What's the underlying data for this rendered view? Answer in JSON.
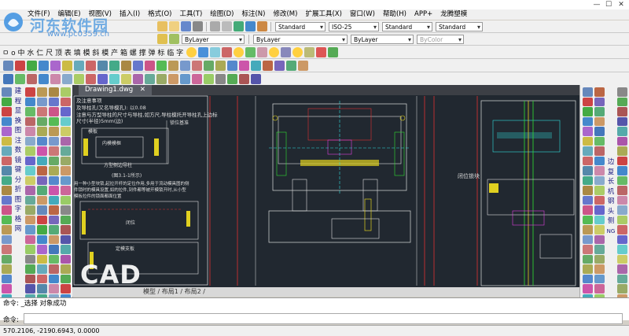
{
  "menu": {
    "items": [
      "文件(F)",
      "编辑(E)",
      "视图(V)",
      "插入(I)",
      "格式(O)",
      "工具(T)",
      "绘图(D)",
      "标注(N)",
      "修改(M)",
      "扩展工具(X)",
      "窗口(W)",
      "帮助(H)",
      "APP+",
      "龙腾塑模"
    ]
  },
  "toolbar": {
    "text_style": "Standard",
    "iso_style": "ISO-25",
    "dim_style": "Standard",
    "table_style": "Standard",
    "layer": "ByLayer",
    "linetype": "ByLayer",
    "lineweight": "ByLayer",
    "color": "ByColor",
    "cjk_row": "ㅁ  o  中  水  仁  尺  顶  表  填  模  斜  模  产  箱  螺  撑  弹  标  临  字"
  },
  "left_labels": [
    "建",
    "程",
    "显",
    "换",
    "图",
    "注",
    "数",
    "镜",
    "键",
    "分",
    "折",
    "图",
    "字",
    "格",
    "网"
  ],
  "right_labels": [
    "边",
    "复",
    "长",
    "机",
    "钢",
    "头",
    "侧",
    "NG"
  ],
  "document": {
    "tab": "Drawing1.dwg",
    "layouts": "模型 / 布局1 / 布局2 /"
  },
  "drawing_notes": {
    "n1": "及注意事项",
    "n2": "及导柱孔(又名导模孔): 以0.08",
    "n3": "注意与方型导柱的尺寸与导柱,如方尺,导柱模托开导柱孔上边标",
    "n4": "尺寸(半径)5mm(边)",
    "mold": "模板",
    "inner": "内模模框",
    "side": "方型侧边导柱",
    "locate": "锁位基准",
    "fig": "(图3.1-1所示)",
    "para1": "用一种小型块锁,起拉开杆的定位作用,多用于流动模具图的侧",
    "para2": "件锁时的模具设置,如的拉件,到件都等被开模锁开时,从小型",
    "para3": "模板拉件的锁面都面位置",
    "fix": "闭位",
    "plate": "定模支板",
    "lock_block": "闭位锁块"
  },
  "command": {
    "line1": "命令: _选择 对象成功",
    "prompt": "命令:"
  },
  "status": {
    "coords": "570.2106, -2190.6943, 0.0000"
  },
  "watermark": {
    "site": "河东软件园",
    "url": "www.pc0359.cn",
    "cad": "CAD"
  }
}
